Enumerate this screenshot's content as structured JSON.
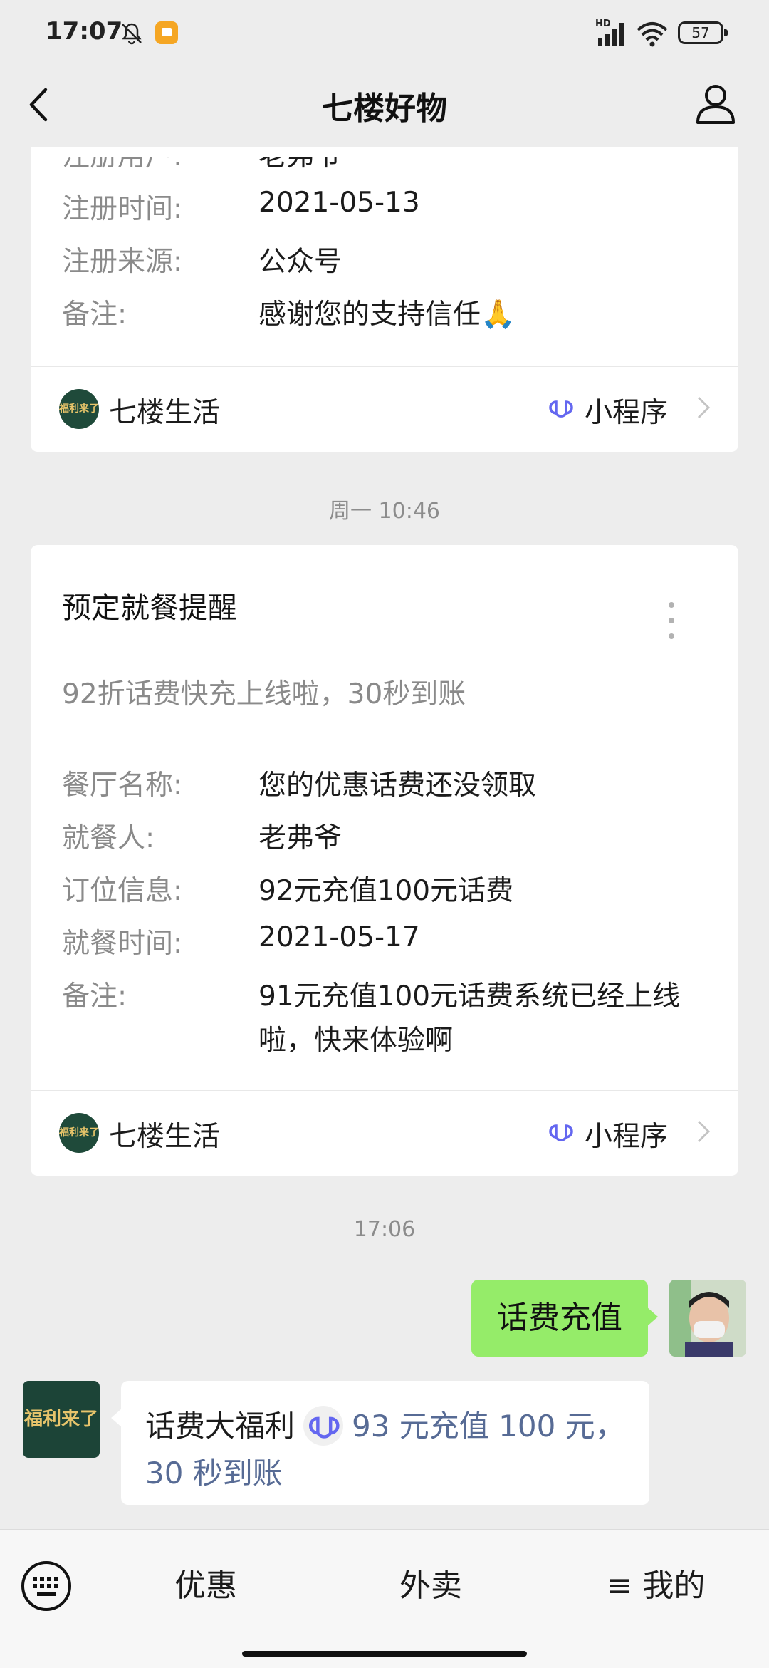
{
  "status": {
    "time": "17:07",
    "battery": "57",
    "network": "HD"
  },
  "nav": {
    "title": "七楼好物"
  },
  "card1": {
    "rows": [
      {
        "label": "注册用户:",
        "value": "老弗爷"
      },
      {
        "label": "注册时间:",
        "value": "2021-05-13"
      },
      {
        "label": "注册来源:",
        "value": "公众号"
      },
      {
        "label": "备注:",
        "value": "感谢您的支持信任🙏"
      }
    ],
    "footer": {
      "name": "七楼生活",
      "mini_program": "小程序",
      "logo_text": "福利来了"
    }
  },
  "timestamp1": "周一 10:46",
  "card2": {
    "title": "预定就餐提醒",
    "subtitle": "92折话费快充上线啦，30秒到账",
    "rows": [
      {
        "label": "餐厅名称:",
        "value": "您的优惠话费还没领取"
      },
      {
        "label": "就餐人:",
        "value": "老弗爷"
      },
      {
        "label": "订位信息:",
        "value": "92元充值100元话费"
      },
      {
        "label": "就餐时间:",
        "value": "2021-05-17"
      },
      {
        "label": "备注:",
        "value": "91元充值100元话费系统已经上线",
        "value2": "啦，快来体验啊"
      }
    ],
    "footer": {
      "name": "七楼生活",
      "mini_program": "小程序",
      "logo_text": "福利来了"
    }
  },
  "timestamp2": "17:06",
  "outgoing": {
    "text": "话费充值"
  },
  "incoming": {
    "avatar_text": "福利来了",
    "prefix": "话费大福利",
    "link_line1": "93 元充值 100 元，",
    "link_line2": "30 秒到账"
  },
  "bottom_menu": {
    "tab1": "优惠",
    "tab2": "外卖",
    "tab3": "≡ 我的"
  },
  "colors": {
    "bubble_out": "#95ec69",
    "link": "#576b95",
    "background": "#ededed"
  }
}
